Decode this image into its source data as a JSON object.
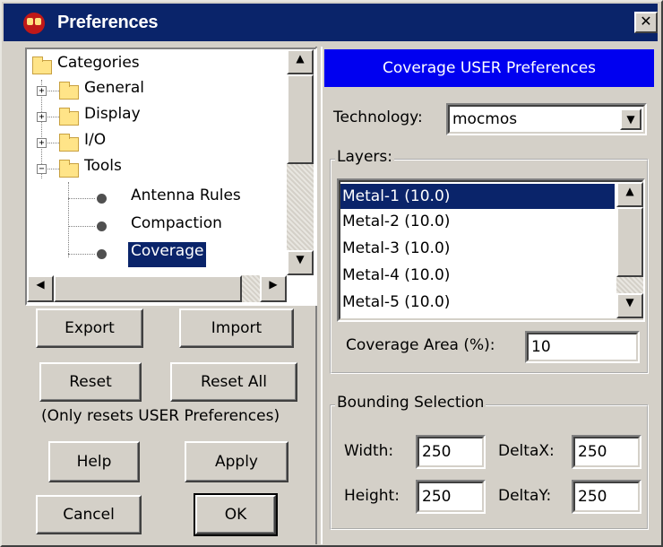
{
  "window": {
    "title": "Preferences",
    "close_symbol": "✕"
  },
  "tree": {
    "root": "Categories",
    "folders": [
      {
        "label": "General",
        "expander": "+"
      },
      {
        "label": "Display",
        "expander": "+"
      },
      {
        "label": "I/O",
        "expander": "+"
      },
      {
        "label": "Tools",
        "expander": "−"
      }
    ],
    "tools_children": [
      "Antenna Rules",
      "Compaction",
      "Coverage"
    ],
    "selected": "Coverage"
  },
  "buttons": {
    "export": "Export",
    "import": "Import",
    "reset": "Reset",
    "reset_all": "Reset All",
    "reset_note": "(Only resets USER Preferences)",
    "help": "Help",
    "apply": "Apply",
    "cancel": "Cancel",
    "ok": "OK"
  },
  "panel": {
    "header": "Coverage USER Preferences",
    "technology_label": "Technology:",
    "technology_value": "mocmos",
    "layers_title": "Layers:",
    "layers": [
      "Metal-1 (10.0)",
      "Metal-2 (10.0)",
      "Metal-3 (10.0)",
      "Metal-4 (10.0)",
      "Metal-5 (10.0)"
    ],
    "coverage_label": "Coverage Area (%):",
    "coverage_value": "10",
    "bounding_title": "Bounding Selection",
    "width_label": "Width:",
    "width_value": "250",
    "deltax_label": "DeltaX:",
    "deltax_value": "250",
    "height_label": "Height:",
    "height_value": "250",
    "deltay_label": "DeltaY:",
    "deltay_value": "250"
  },
  "colors": {
    "title_bar": "#0a246a",
    "panel_header": "#0000f0",
    "selection": "#0a246a",
    "face": "#d4d0c8"
  }
}
